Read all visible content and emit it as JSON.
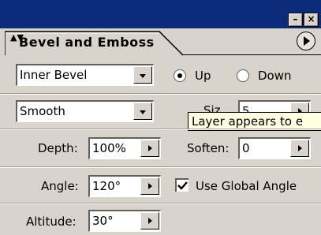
{
  "window": {
    "minimize_glyph": "–",
    "close_glyph": "×"
  },
  "tab": {
    "arrows_glyph": "▲▼",
    "title": "Bevel and Emboss"
  },
  "structure": {
    "style_value": "Inner Bevel",
    "direction_up_label": "Up",
    "direction_down_label": "Down",
    "direction_selected": "Up",
    "technique_value": "Smooth",
    "size_label_partial": "Siz",
    "size_value_partial": "5",
    "depth_label": "Depth:",
    "depth_value": "100%",
    "soften_label": "Soften:",
    "soften_value": "0"
  },
  "shading": {
    "angle_label": "Angle:",
    "angle_value": "120°",
    "use_global_label": "Use Global Angle",
    "use_global_checked": true,
    "altitude_label": "Altitude:",
    "altitude_value": "30°"
  },
  "tooltip": {
    "text": "Layer appears to e"
  },
  "colors": {
    "titlebar": "#0c2b7a",
    "panel": "#d8d4cc",
    "tooltip_bg": "#ffffe1"
  }
}
